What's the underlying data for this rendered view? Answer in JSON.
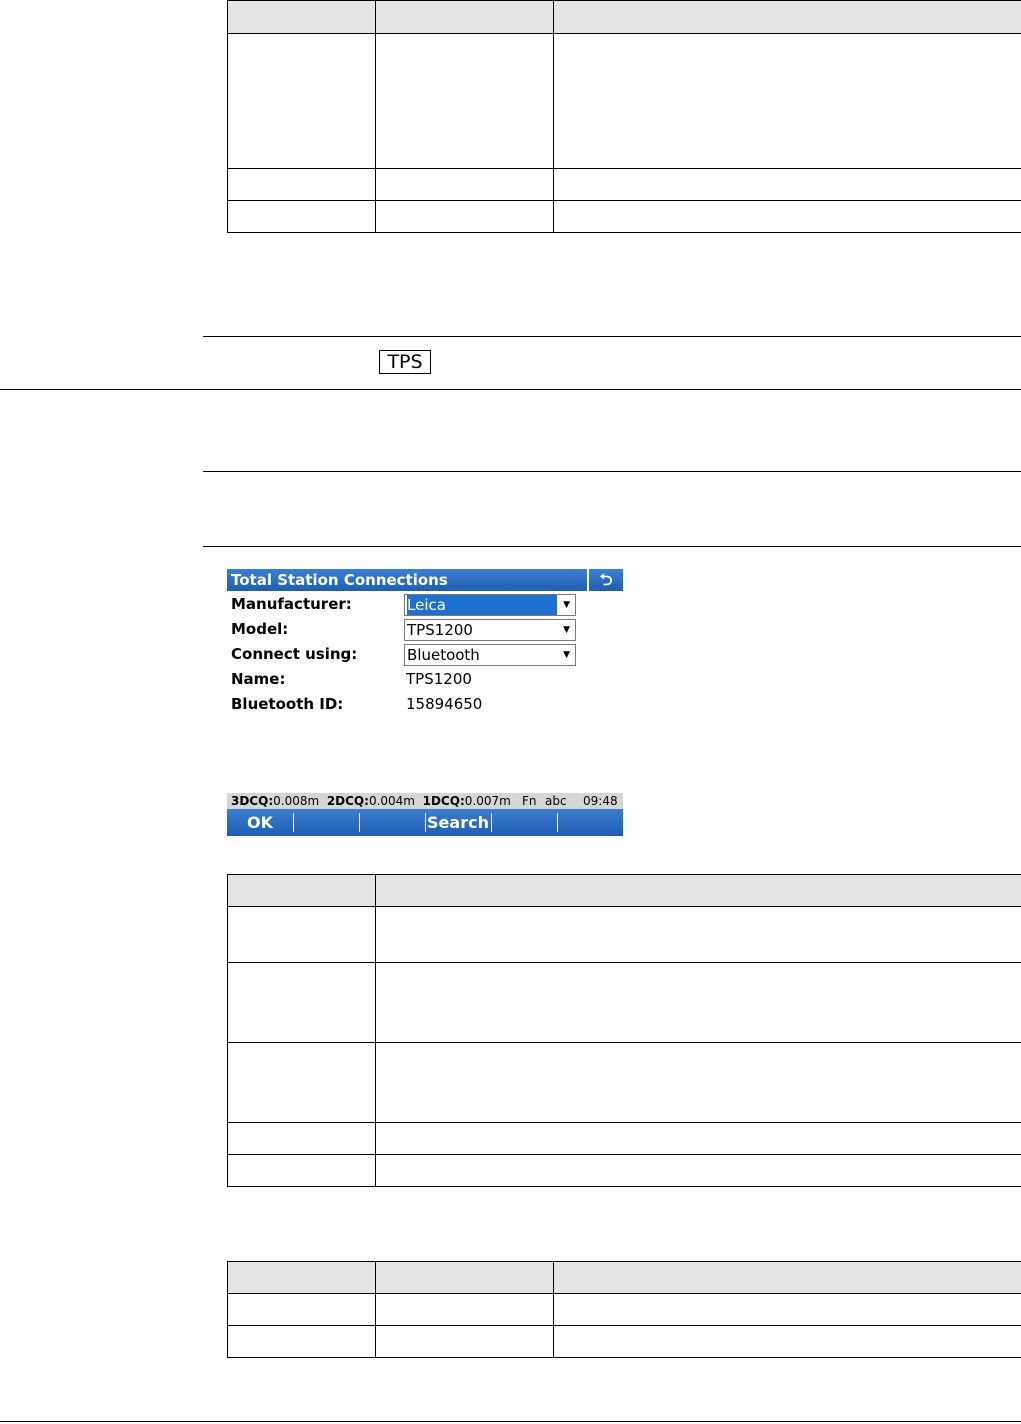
{
  "key_label": "TPS",
  "screen": {
    "title": "Total Station Connections",
    "back_icon": "undo-arrow-icon",
    "fields": {
      "manufacturer": {
        "label": "Manufacturer:",
        "value": "Leica"
      },
      "model": {
        "label": "Model:",
        "value": "TPS1200"
      },
      "connect_using": {
        "label": "Connect using:",
        "value": "Bluetooth"
      },
      "name": {
        "label": "Name:",
        "value": "TPS1200"
      },
      "bluetooth_id": {
        "label": "Bluetooth ID:",
        "value": "15894650"
      }
    },
    "status": {
      "q3_label": "3DCQ:",
      "q3_value": "0.008m",
      "q2_label": "2DCQ:",
      "q2_value": "0.004m",
      "q1_label": "1DCQ:",
      "q1_value": "0.007m",
      "fn": "Fn",
      "mode": "abc",
      "time": "09:48"
    },
    "softkeys": {
      "ok": "OK",
      "search": "Search"
    }
  },
  "colors": {
    "title_bar": "#1f5eb0",
    "selection": "#1f6fd0",
    "table_header": "#e4e4e4"
  }
}
